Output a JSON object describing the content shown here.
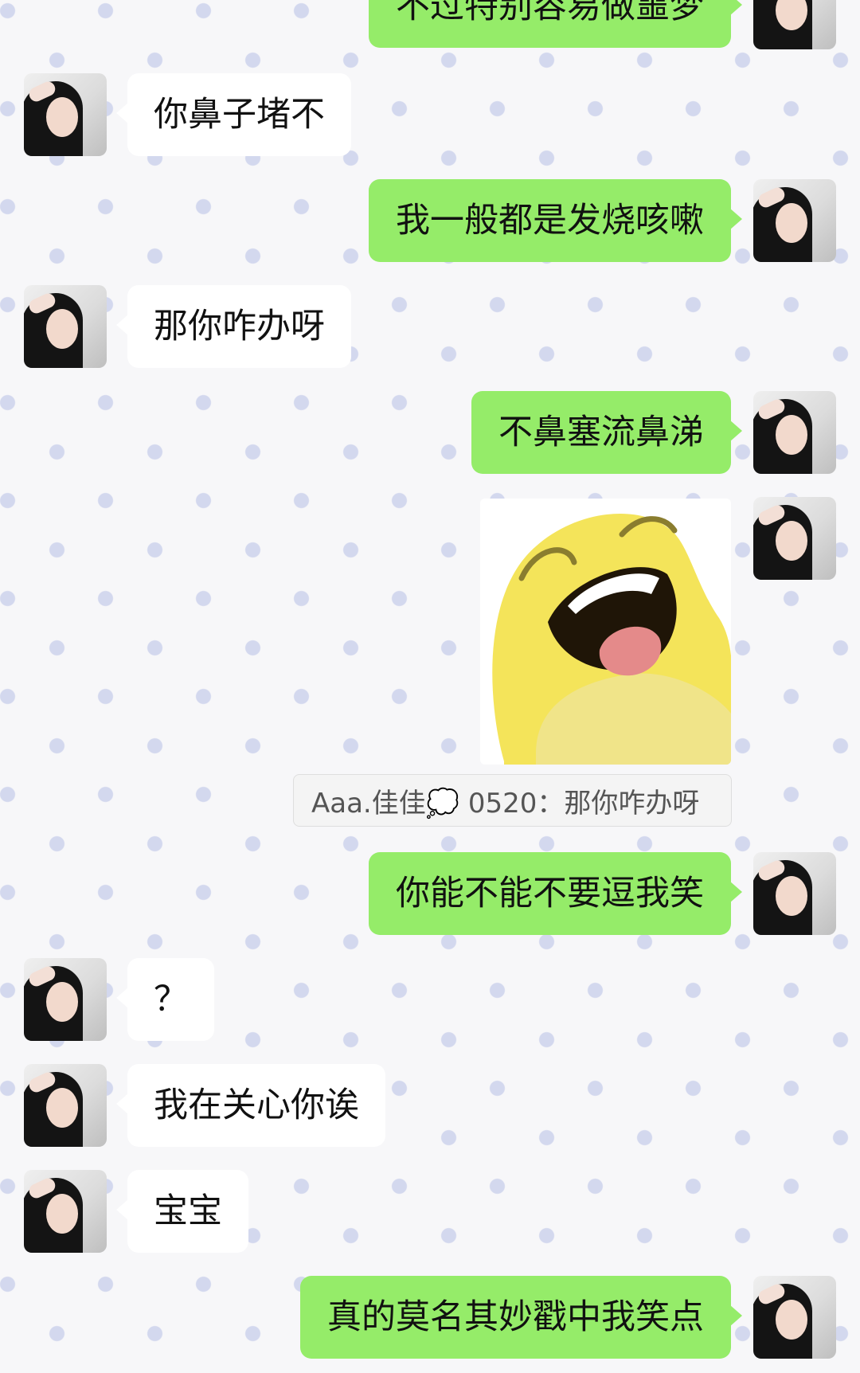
{
  "messages": [
    {
      "side": "out",
      "text": "不过特别容易做噩梦"
    },
    {
      "side": "in",
      "text": "你鼻子堵不"
    },
    {
      "side": "out",
      "text": "我一般都是发烧咳嗽"
    },
    {
      "side": "in",
      "text": "那你咋办呀"
    },
    {
      "side": "out",
      "text": "不鼻塞流鼻涕"
    },
    {
      "side": "out",
      "type": "sticker",
      "sticker": "laughing-yellow-bird-sticker"
    },
    {
      "quote": "Aaa.佳佳💭 0520：那你咋办呀"
    },
    {
      "side": "out",
      "text": "你能不能不要逗我笑"
    },
    {
      "side": "in",
      "text": "？"
    },
    {
      "side": "in",
      "text": "我在关心你诶"
    },
    {
      "side": "in",
      "text": "宝宝"
    },
    {
      "side": "out",
      "text": "真的莫名其妙戳中我笑点"
    }
  ],
  "colors": {
    "outgoing_bubble": "#95ec69",
    "incoming_bubble": "#ffffff",
    "dots": "#d3d8ee"
  }
}
